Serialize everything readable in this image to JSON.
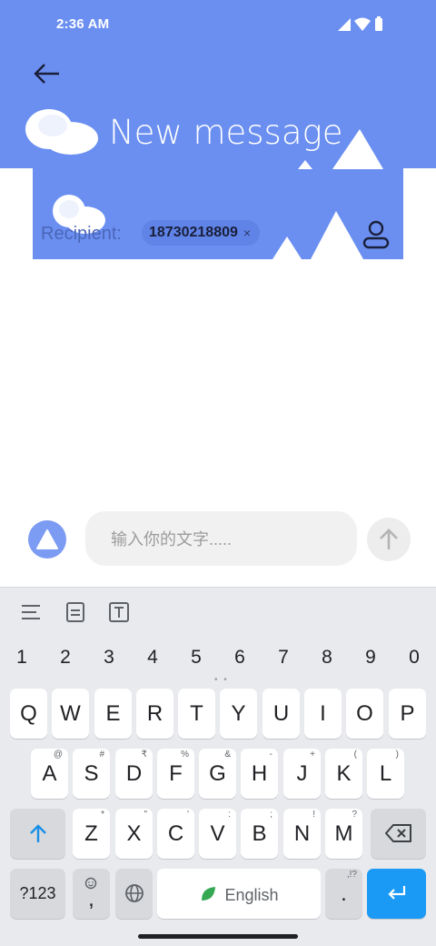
{
  "status_bar": {
    "time": "2:36 AM"
  },
  "header": {
    "title": "New message",
    "recipient_label": "Recipient:",
    "recipient_chip": "18730218809",
    "chip_remove": "×"
  },
  "compose": {
    "placeholder": "输入你的文字....."
  },
  "keyboard": {
    "number_row": [
      "1",
      "2",
      "3",
      "4",
      "5",
      "6",
      "7",
      "8",
      "9",
      "0"
    ],
    "row1": [
      "Q",
      "W",
      "E",
      "R",
      "T",
      "Y",
      "U",
      "I",
      "O",
      "P"
    ],
    "row2": [
      {
        "key": "A",
        "hint": "@"
      },
      {
        "key": "S",
        "hint": "#"
      },
      {
        "key": "D",
        "hint": "₹"
      },
      {
        "key": "F",
        "hint": "%"
      },
      {
        "key": "G",
        "hint": "&"
      },
      {
        "key": "H",
        "hint": "-"
      },
      {
        "key": "J",
        "hint": "+"
      },
      {
        "key": "K",
        "hint": "("
      },
      {
        "key": "L",
        "hint": ")"
      }
    ],
    "row3": [
      {
        "key": "Z",
        "hint": "*"
      },
      {
        "key": "X",
        "hint": "\""
      },
      {
        "key": "C",
        "hint": "'"
      },
      {
        "key": "V",
        "hint": ":"
      },
      {
        "key": "B",
        "hint": ";"
      },
      {
        "key": "N",
        "hint": "!"
      },
      {
        "key": "M",
        "hint": "?"
      }
    ],
    "symbols_label": "?123",
    "comma_label": ",",
    "space_label": "English",
    "period_label": ".",
    "period_hint": ",!?"
  },
  "colors": {
    "header": "#6b8ff0",
    "accent": "#1a9af5"
  }
}
